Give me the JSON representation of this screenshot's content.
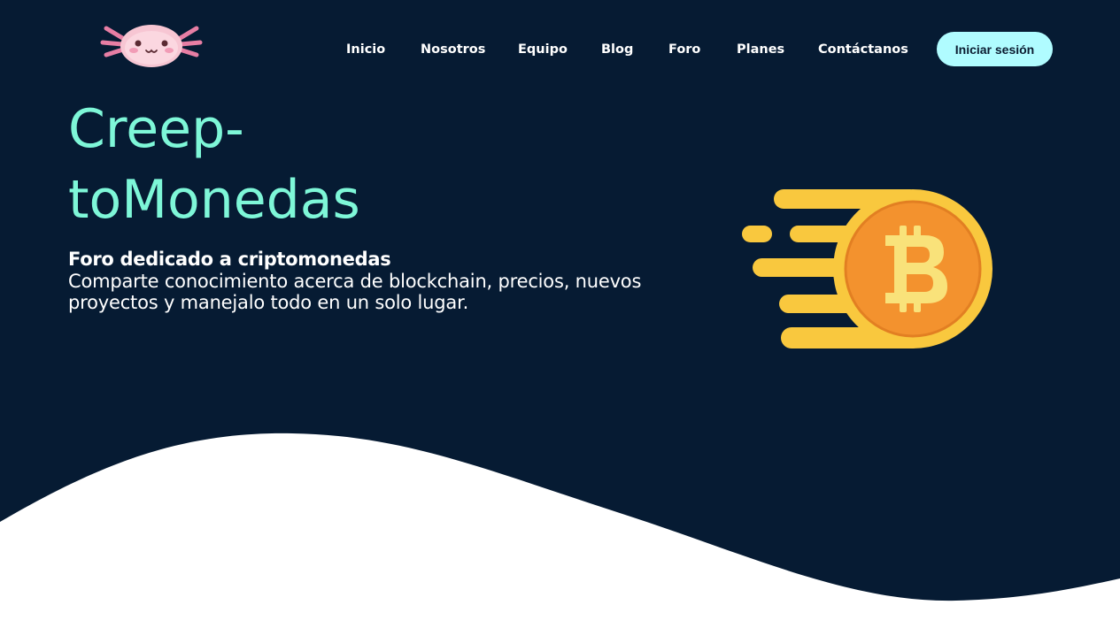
{
  "brand": {
    "logo_icon": "axolotl-logo"
  },
  "nav": {
    "items": [
      {
        "label": "Inicio"
      },
      {
        "label": "Nosotros"
      },
      {
        "label": "Equipo"
      },
      {
        "label": "Blog"
      },
      {
        "label": "Foro"
      },
      {
        "label": "Planes"
      },
      {
        "label": "Contáctanos"
      }
    ],
    "login_label": "Iniciar sesión"
  },
  "hero": {
    "title_line1": "Creep-",
    "title_line2": "toMonedas",
    "subtitle": "Foro dedicado a criptomonedas",
    "description": "Comparte conocimiento acerca de blockchain, precios, nuevos proyectos y manejalo todo en un solo lugar.",
    "illustration_icon": "bitcoin-coin-icon"
  },
  "colors": {
    "background": "#061b33",
    "accent_title": "#7ef7d8",
    "login_button": "#b0fcff",
    "coin_gold": "#f9c83e",
    "coin_orange": "#f3922e"
  }
}
